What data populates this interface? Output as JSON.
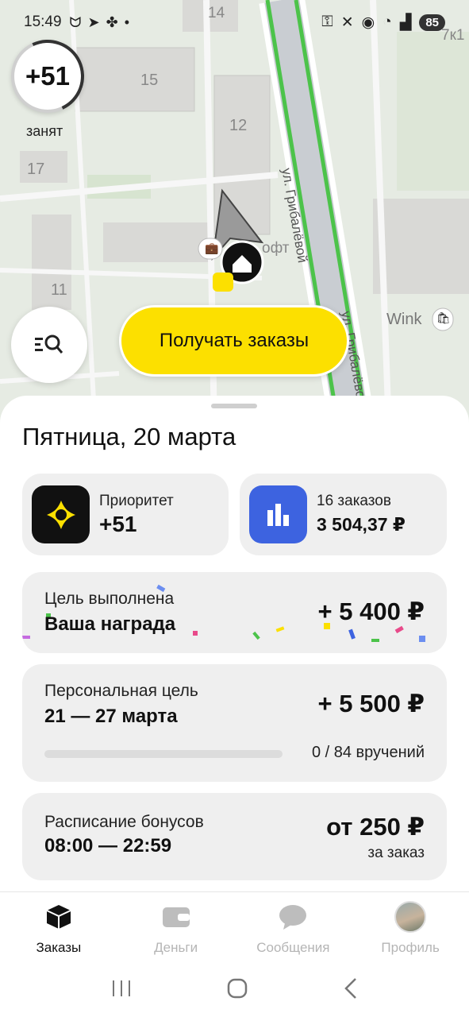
{
  "status_bar": {
    "time": "15:49",
    "battery": "85"
  },
  "map": {
    "house_numbers": [
      "14",
      "15",
      "12",
      "17",
      "11",
      "7к1"
    ],
    "street_labels": [
      "ул. Грибалёвой",
      "ул. Грибалёвой"
    ],
    "poi_labels": [
      "офт",
      "Wink"
    ],
    "priority_badge": "+51",
    "status_label": "занят",
    "get_orders_label": "Получать заказы"
  },
  "sheet": {
    "date_title": "Пятница, 20 марта",
    "priority_tile": {
      "label": "Приоритет",
      "value": "+51"
    },
    "orders_tile": {
      "label": "16 заказов",
      "value": "3 504,37 ₽"
    },
    "goal_done": {
      "label": "Цель выполнена",
      "title": "Ваша награда",
      "amount": "+ 5 400 ₽"
    },
    "personal_goal": {
      "label": "Персональная цель",
      "dates": "21 — 27 марта",
      "amount": "+ 5 500 ₽",
      "progress_text": "0 / 84 вручений",
      "progress": 0
    },
    "bonus_schedule": {
      "label": "Расписание бонусов",
      "hours": "08:00 — 22:59",
      "amount": "от 250 ₽",
      "sub": "за заказ"
    }
  },
  "bottom_nav": [
    {
      "label": "Заказы",
      "icon": "box-icon",
      "active": true
    },
    {
      "label": "Деньги",
      "icon": "wallet-icon",
      "active": false
    },
    {
      "label": "Сообщения",
      "icon": "chat-icon",
      "active": false
    },
    {
      "label": "Профиль",
      "icon": "avatar",
      "active": false
    }
  ],
  "colors": {
    "accent_yellow": "#fce000",
    "orders_blue": "#3d63e0",
    "road_green": "#4cc34a"
  }
}
